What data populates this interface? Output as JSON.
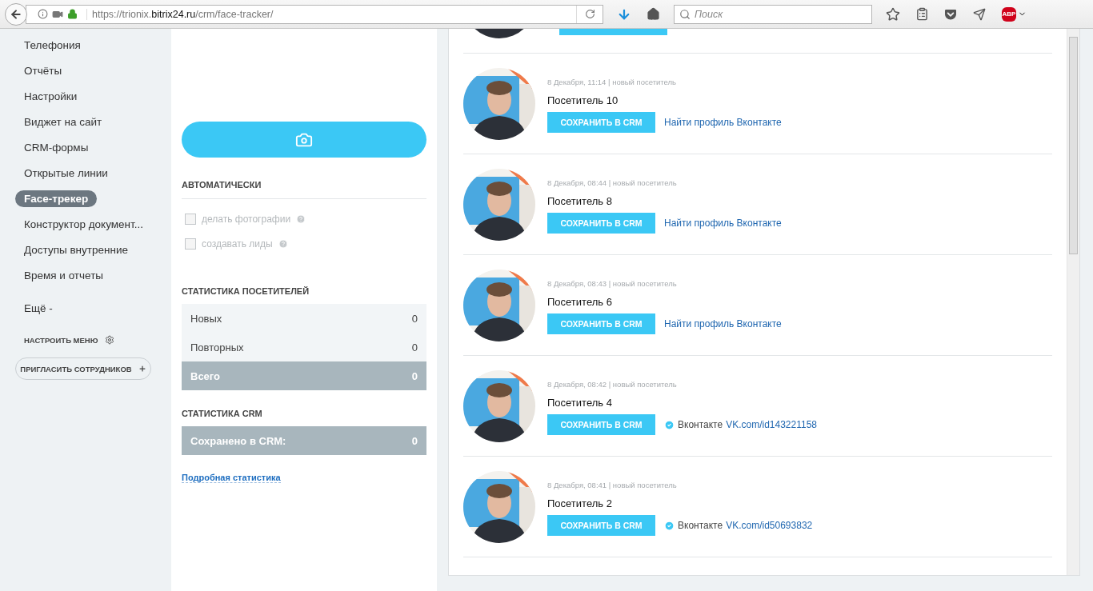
{
  "browser": {
    "url": {
      "prefix": "https://trionix.",
      "domain": "bitrix24.ru",
      "path": "/crm/face-tracker/"
    },
    "search": {
      "placeholder": "Поиск"
    },
    "adblock_badge": "ABP"
  },
  "sidebar": {
    "items": [
      {
        "label": "Телефония",
        "selected": false
      },
      {
        "label": "Отчёты",
        "selected": false
      },
      {
        "label": "Настройки",
        "selected": false
      },
      {
        "label": "Виджет на сайт",
        "selected": false
      },
      {
        "label": "CRM-формы",
        "selected": false
      },
      {
        "label": "Открытые линии",
        "selected": false
      },
      {
        "label": "Face-трекер",
        "selected": true
      },
      {
        "label": "Конструктор документ...",
        "selected": false
      },
      {
        "label": "Доступы внутренние",
        "selected": false
      },
      {
        "label": "Время и отчеты",
        "selected": false
      }
    ],
    "more": "Ещё -",
    "configure": "НАСТРОИТЬ МЕНЮ",
    "invite": "ПРИГЛАСИТЬ СОТРУДНИКОВ"
  },
  "controls": {
    "auto_heading": "АВТОМАТИЧЕСКИ",
    "options": [
      {
        "label": "делать фотографии",
        "checked": false
      },
      {
        "label": "создавать лиды",
        "checked": false
      }
    ],
    "visitor_stats_heading": "СТАТИСТИКА ПОСЕТИТЕЛЕЙ",
    "visitor_stats": [
      {
        "label": "Новых",
        "value": "0",
        "kind": "plain"
      },
      {
        "label": "Повторных",
        "value": "0",
        "kind": "plain"
      },
      {
        "label": "Всего",
        "value": "0",
        "kind": "total"
      }
    ],
    "crm_stats_heading": "СТАТИСТИКА CRM",
    "crm_stats": [
      {
        "label": "Сохранено в CRM:",
        "value": "0",
        "kind": "total"
      }
    ],
    "details_link": "Подробная статистика"
  },
  "visitors": [
    {
      "meta": "8 Декабря, 11:14 | новый посетитель",
      "name": "Посетитель 10",
      "button": "СОХРАНИТЬ В CRM",
      "vk": {
        "kind": "search",
        "link": "Найти профиль Вконтакте"
      }
    },
    {
      "meta": "8 Декабря, 08:44 | новый посетитель",
      "name": "Посетитель 8",
      "button": "СОХРАНИТЬ В CRM",
      "vk": {
        "kind": "search",
        "link": "Найти профиль Вконтакте"
      }
    },
    {
      "meta": "8 Декабря, 08:43 | новый посетитель",
      "name": "Посетитель 6",
      "button": "СОХРАНИТЬ В CRM",
      "vk": {
        "kind": "search",
        "link": "Найти профиль Вконтакте"
      }
    },
    {
      "meta": "8 Декабря, 08:42 | новый посетитель",
      "name": "Посетитель 4",
      "button": "СОХРАНИТЬ В CRM",
      "vk": {
        "kind": "found",
        "label": "Вконтакте",
        "link": "VK.com/id143221158"
      }
    },
    {
      "meta": "8 Декабря, 08:41 | новый посетитель",
      "name": "Посетитель 2",
      "button": "СОХРАНИТЬ В CRM",
      "vk": {
        "kind": "found",
        "label": "Вконтакте",
        "link": "VK.com/id50693832"
      }
    }
  ]
}
